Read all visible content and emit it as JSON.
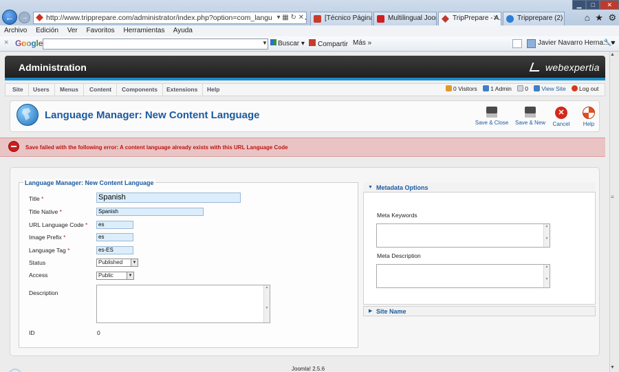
{
  "browser": {
    "address": "http://www.tripprepare.com/administrator/index.php?option=com_languages&view=language",
    "tabs": [
      {
        "label": "[Técnico Páginas ..."
      },
      {
        "label": "Multilingual Joom..."
      },
      {
        "label": "TripPrepare - A..."
      },
      {
        "label": "Tripprepare (2)"
      }
    ],
    "menu": [
      "Archivo",
      "Edición",
      "Ver",
      "Favoritos",
      "Herramientas",
      "Ayuda"
    ],
    "google": {
      "logo": "Google",
      "buscar": "Buscar",
      "compartir": "Compartir",
      "mas": "Más »",
      "user": "Javier Navarro Herna..."
    }
  },
  "admin": {
    "title": "Administration",
    "brand": "webexpertia"
  },
  "nav": [
    "Site",
    "Users",
    "Menus",
    "Content",
    "Components",
    "Extensions",
    "Help"
  ],
  "status": {
    "visitors": "0 Visitors",
    "admin": "1 Admin",
    "messages": "0",
    "view_site": "View Site",
    "logout": "Log out"
  },
  "toolbar": {
    "title": "Language Manager: New Content Language",
    "save_close": "Save & Close",
    "save_new": "Save & New",
    "cancel": "Cancel",
    "help": "Help"
  },
  "error": "Save failed with the following error: A content language already exists with this URL Language Code",
  "form": {
    "legend": "Language Manager: New Content Language",
    "title_label": "Title",
    "title_value": "Spanish",
    "title_native_label": "Title Native",
    "title_native_value": "Spanish",
    "url_code_label": "URL Language Code",
    "url_code_value": "es",
    "image_prefix_label": "Image Prefix",
    "image_prefix_value": "es",
    "lang_tag_label": "Language Tag",
    "lang_tag_value": "es-ES",
    "status_label": "Status",
    "status_value": "Published",
    "access_label": "Access",
    "access_value": "Public",
    "description_label": "Description",
    "id_label": "ID",
    "id_value": "0",
    "required_mark": "*"
  },
  "metadata": {
    "title": "Metadata Options",
    "keywords_label": "Meta Keywords",
    "description_label": "Meta Description",
    "site_name": "Site Name"
  },
  "footer": "Joomla! 2.5.6",
  "colors": {
    "accent": "#1d5aa0",
    "error_bg": "#eac4c4",
    "error_text": "#c01212",
    "header_bg": "#1f1f1f",
    "header_stripe": "#1d8ac8"
  }
}
